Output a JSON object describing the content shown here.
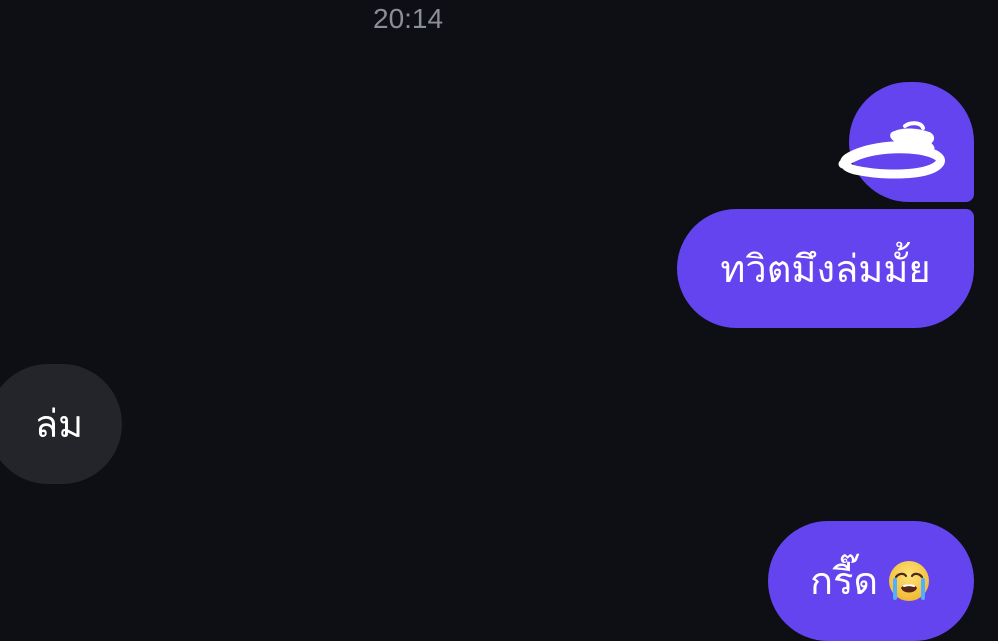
{
  "chat": {
    "timestamp": "20:14",
    "messages": [
      {
        "side": "sent",
        "type": "image",
        "content": "",
        "icon": "scribble-sticker-icon"
      },
      {
        "side": "sent",
        "type": "text",
        "text": "ทวิตมึงล่มมั้ย"
      },
      {
        "side": "received",
        "type": "text",
        "text": "ล่ม"
      },
      {
        "side": "sent",
        "type": "text",
        "text": "กรี๊ด",
        "emoji": "crying-face-icon"
      }
    ]
  },
  "theme": {
    "background": "#0d0f14",
    "sent_bubble": "#6444ef",
    "received_bubble": "#23252b",
    "timestamp_color": "#8b8e96",
    "text_color": "#ffffff"
  }
}
